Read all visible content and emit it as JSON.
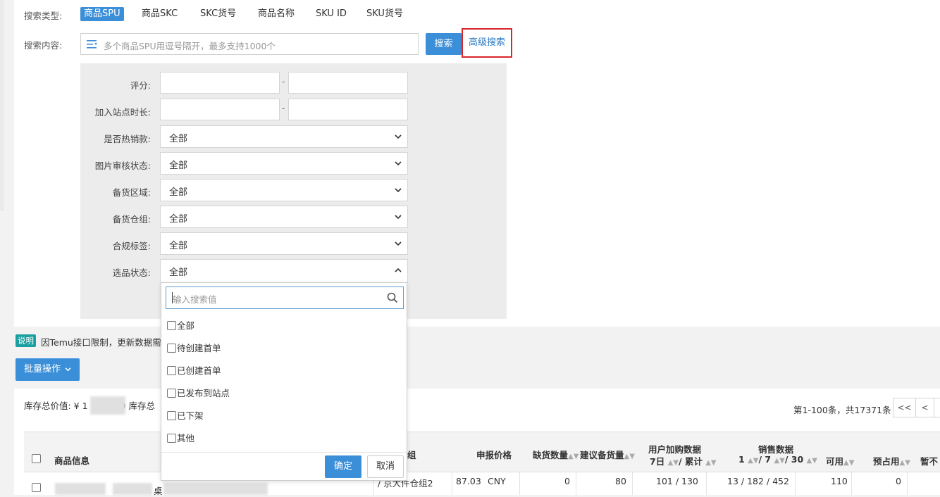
{
  "search_type": {
    "label": "搜索类型:",
    "tabs": [
      "商品SPU",
      "商品SKC",
      "SKC货号",
      "商品名称",
      "SKU ID",
      "SKU货号"
    ]
  },
  "search_content": {
    "label": "搜索内容:",
    "placeholder": "多个商品SPU用逗号隔开，最多支持1000个",
    "search_button": "搜索",
    "advanced_button": "高级搜索"
  },
  "advanced": {
    "rating_label": "评分:",
    "site_duration_label": "加入站点时长:",
    "range_sep": "-",
    "fields": [
      {
        "label": "是否热销款:",
        "value": "全部"
      },
      {
        "label": "图片审核状态:",
        "value": "全部"
      },
      {
        "label": "备货区域:",
        "value": "全部"
      },
      {
        "label": "备货仓组:",
        "value": "全部"
      },
      {
        "label": "合规标签:",
        "value": "全部"
      },
      {
        "label": "选品状态:",
        "value": "全部"
      }
    ]
  },
  "dropdown": {
    "search_placeholder": "输入搜索值",
    "options": [
      "全部",
      "待创建首单",
      "已创建首单",
      "已发布到站点",
      "已下架",
      "其他"
    ],
    "confirm": "确定",
    "cancel": "取消"
  },
  "notice": {
    "badge": "说明",
    "text": "因Temu接口限制，更新数据需"
  },
  "batch_button": "批量操作",
  "stats": {
    "prefix": "库存总价值: ¥ 1",
    "mid": "9 库存总"
  },
  "pager": {
    "text": "第1-100条，共17371条",
    "first": "<<",
    "prev": "<"
  },
  "table": {
    "headers": {
      "product_info": "商品信息",
      "group_tail": "组",
      "declare_price": "申报价格",
      "shortage": "缺货数量",
      "suggest_stock": "建议备货量",
      "cart_title": "用户加购数据",
      "cart_sub_a": "7日",
      "cart_sub_b": "/ 累计",
      "sales_title": "销售数据",
      "sales_a": "1",
      "sales_b": "/ 7",
      "sales_c": "/ 30",
      "available": "可用",
      "reserved": "预占用",
      "tail": "暂不"
    },
    "row": {
      "name_tail": "桌",
      "warehouse": "/ 京大件仓组2",
      "price": "87.03",
      "currency": "CNY",
      "shortage": "0",
      "suggest": "80",
      "cart": "101 /  130",
      "sales": "13 /  182 /  452",
      "available": "110",
      "reserved": "0"
    }
  },
  "colors": {
    "primary": "#3b8fd9",
    "highlight_border": "#d9262b",
    "badge": "#1a9fa0"
  }
}
